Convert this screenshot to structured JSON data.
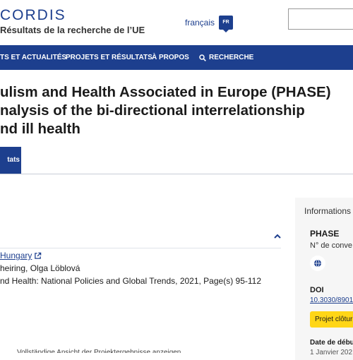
{
  "header": {
    "logo_text": "CORDIS",
    "subtitle": "Résultats de la recherche de l’UE",
    "language": {
      "label": "français",
      "code": "FR"
    },
    "search": {
      "placeholder": ""
    }
  },
  "nav": {
    "items": [
      {
        "label": "TS ET ACTUALITÉS"
      },
      {
        "label": "PROJETS ET RÉSULTATS"
      },
      {
        "label": "À PROPOS"
      },
      {
        "label": "RECHERCHE",
        "icon": "search-icon"
      }
    ]
  },
  "page": {
    "title_lines": [
      "ulism and Health Associated in Europe (PHASE)",
      "nalysis of the bi-directional interrelationship",
      "nd ill health"
    ]
  },
  "tabs": {
    "active_label": "tats"
  },
  "publication": {
    "link_text": "Hungary",
    "authors": "heiring, Olga Löblová",
    "journal": "nd Health: National Policies and Global Trends, 2021, Page(s) 95-112"
  },
  "sidebar": {
    "heading": "Informations",
    "acronym": "PHASE",
    "number_label": "N° de conve",
    "doi_label": "DOI",
    "doi_value": "10.3030/8901",
    "status_badge": "Projet clôtur",
    "start_date_label": "Date de débu",
    "start_date_value": "1 Janvier 202"
  },
  "footer_partial": {
    "text": "Vollständige Ansicht der Projektergebnisse anzeigen"
  },
  "colors": {
    "brand": "#1d3f8e",
    "badge": "#ffd617",
    "sidebar_bg": "#f6f6f6"
  }
}
